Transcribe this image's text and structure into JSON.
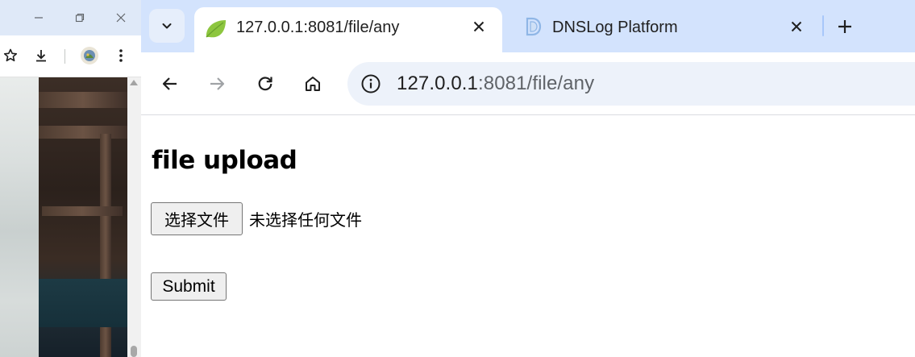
{
  "browser": {
    "tabs": [
      {
        "title": "127.0.0.1:8081/file/any",
        "icon": "spring-leaf-icon",
        "active": true
      },
      {
        "title": "DNSLog Platform",
        "icon": "dnslog-favicon-icon",
        "active": false
      }
    ],
    "address_bar": {
      "host": "127.0.0.1",
      "rest": ":8081/file/any"
    }
  },
  "page": {
    "heading": "file upload",
    "choose_file_label": "选择文件",
    "no_file_label": "未选择任何文件",
    "submit_label": "Submit"
  },
  "colors": {
    "tab_strip": "#d3e3fd",
    "omnibox": "#edf2fa",
    "button_bg": "#efefef",
    "button_border": "#767676"
  }
}
